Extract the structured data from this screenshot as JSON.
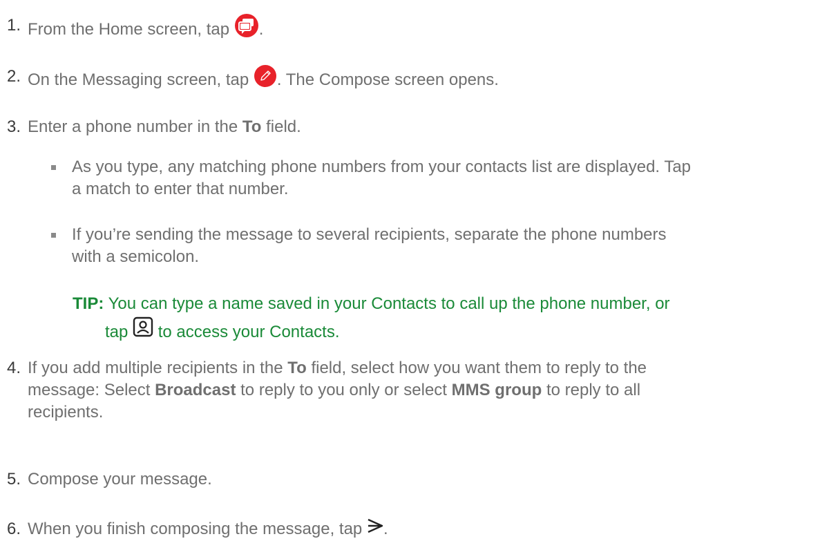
{
  "steps": [
    {
      "num": "1.",
      "a": "From the Home screen, tap",
      "b": "."
    },
    {
      "num": "2.",
      "a": "On the Messaging screen, tap",
      "b": ". The Compose screen opens."
    },
    {
      "num": "3.",
      "a": "Enter a phone number in the",
      "bold": "To",
      "b": "field."
    },
    {
      "num": "4.",
      "a": "If you add multiple recipients in the",
      "bold1": "To",
      "b": "field, select how you want them to reply to the",
      "c": "message: Select",
      "bold2": "Broadcast",
      "d": "to reply to you only or select",
      "bold3": "MMS group",
      "e": "to reply to all",
      "f": "recipients."
    },
    {
      "num": "5.",
      "a": "Compose your message."
    },
    {
      "num": "6.",
      "a": "When you finish composing the message, tap",
      "b": "."
    }
  ],
  "bullets": [
    {
      "line1": "As you type, any matching phone numbers from your contacts list are displayed. Tap",
      "line2": "a match to enter that number."
    },
    {
      "line1": "If you’re sending the message to several recipients, separate the phone numbers",
      "line2": "with a semicolon."
    }
  ],
  "tip": {
    "label": "TIP:",
    "line1": "You can type a name saved in your Contacts to call up the phone number, or",
    "pre_icon": "tap",
    "post_icon": "to access your Contacts."
  },
  "icons": {
    "messaging": "messaging-app-icon",
    "compose": "compose-pencil-icon",
    "contacts": "contacts-icon",
    "send": "send-arrow-icon"
  },
  "colors": {
    "accent_red": "#e8222a",
    "tip_green": "#1a8a38",
    "body_text": "#6f6f6f"
  }
}
